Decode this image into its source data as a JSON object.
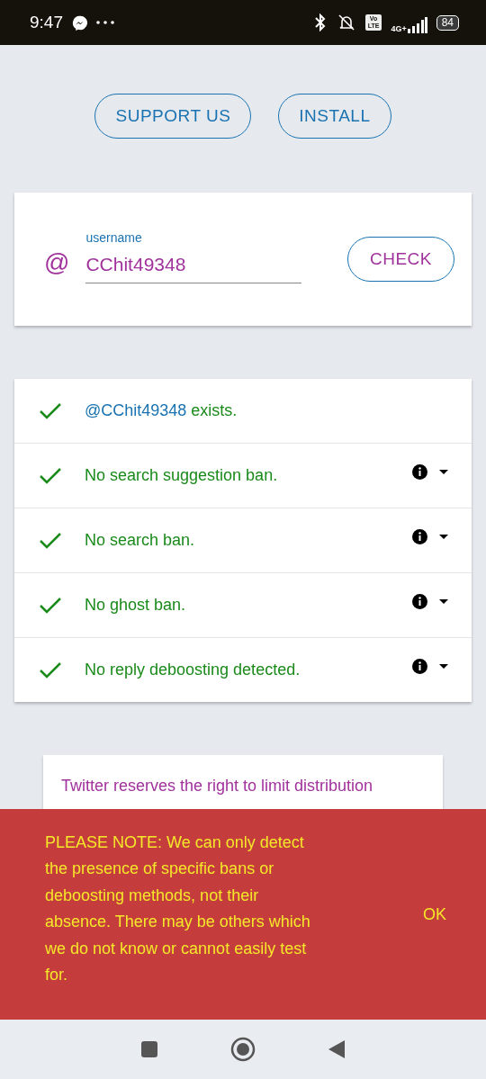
{
  "status_bar": {
    "time": "9:47",
    "volte": [
      "Vo",
      "LTE"
    ],
    "network": "4G+",
    "battery": "84"
  },
  "top_buttons": [
    "SUPPORT US",
    "INSTALL"
  ],
  "username_card": {
    "prefix": "@",
    "label": "username",
    "value": "CChit49348",
    "button": "CHECK"
  },
  "results": [
    {
      "handle": "@CChit49348",
      "text": "exists.",
      "passed": true,
      "expandable": false
    },
    {
      "text": "No search suggestion ban.",
      "passed": true,
      "expandable": true
    },
    {
      "text": "No search ban.",
      "passed": true,
      "expandable": true
    },
    {
      "text": "No ghost ban.",
      "passed": true,
      "expandable": true
    },
    {
      "text": "No reply deboosting detected.",
      "passed": true,
      "expandable": true
    }
  ],
  "note_card": {
    "text": "Twitter reserves the right to limit distribution"
  },
  "snackbar": {
    "message": "PLEASE NOTE: We can only detect the presence of specific bans or deboosting methods, not their absence. There may be others which we do not know or cannot easily test for.",
    "action": "OK"
  }
}
